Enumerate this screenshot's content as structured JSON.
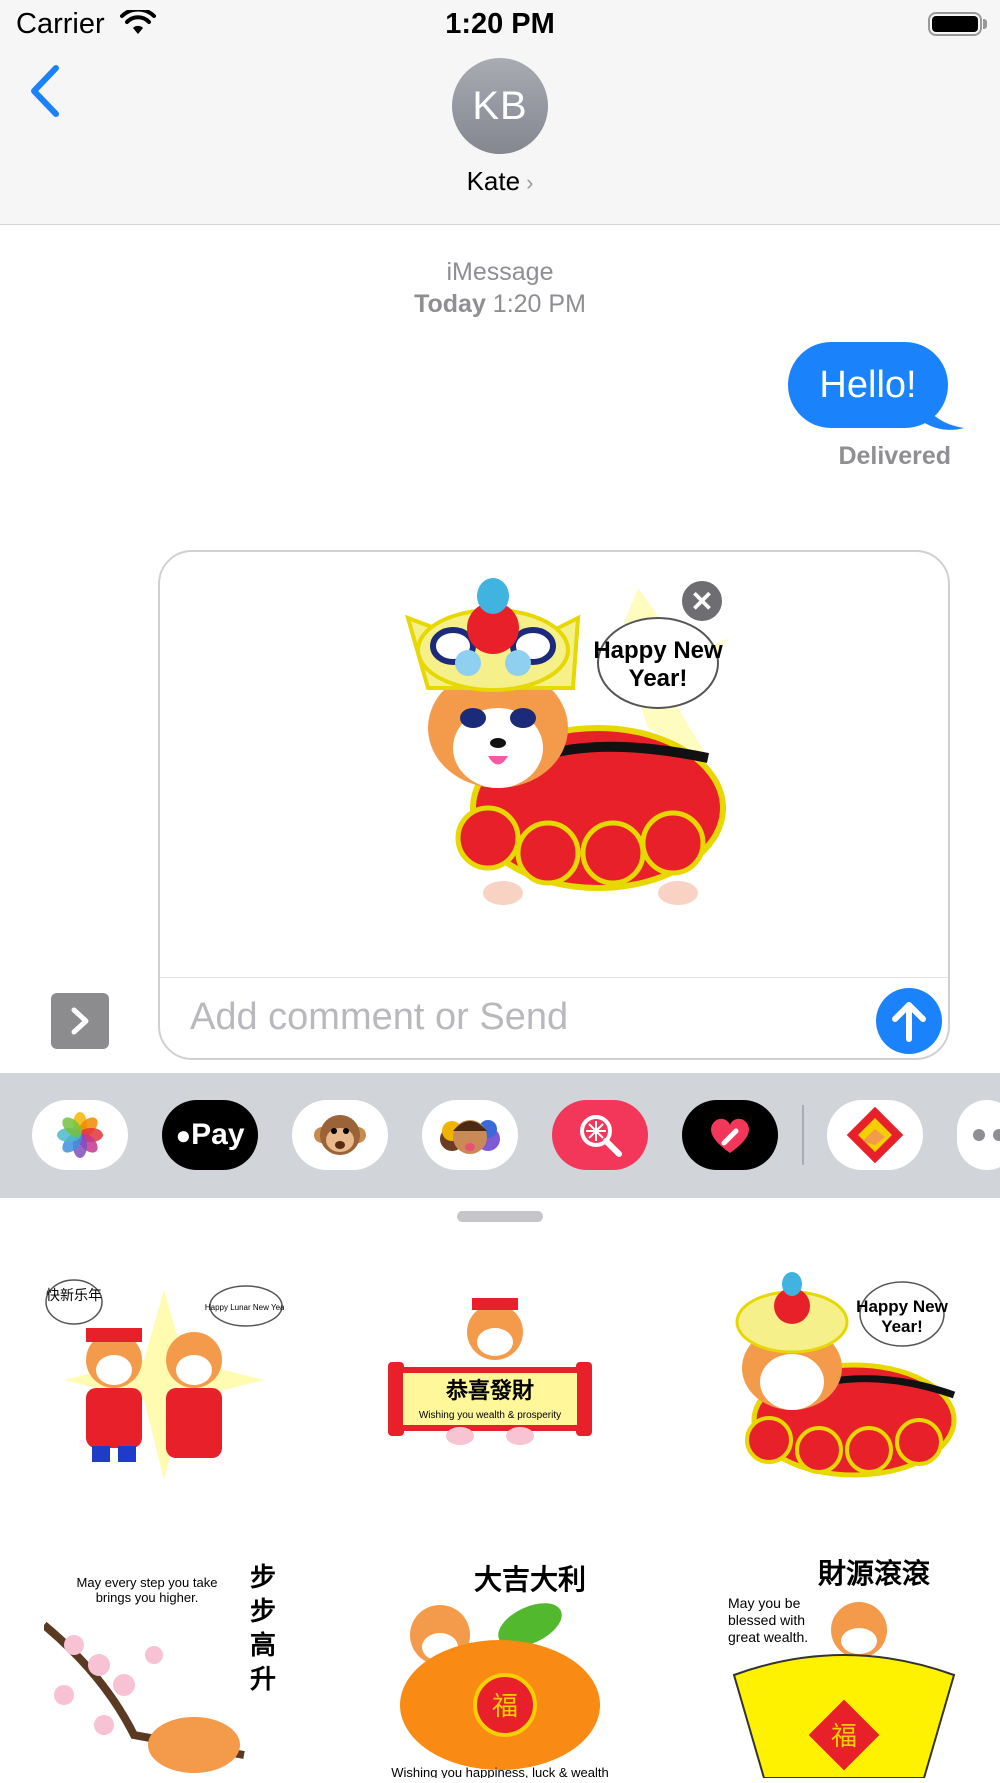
{
  "status_bar": {
    "carrier": "Carrier",
    "time": "1:20 PM"
  },
  "header": {
    "avatar_initials": "KB",
    "contact_name": "Kate",
    "contact_chevron": "›"
  },
  "conversation": {
    "service": "iMessage",
    "timestamp_day": "Today",
    "timestamp_time": "1:20 PM",
    "messages": [
      {
        "text": "Hello!",
        "direction": "outgoing",
        "status": "Delivered"
      }
    ]
  },
  "compose": {
    "preview_sticker": {
      "text_line1": "Happy New",
      "text_line2": "Year!"
    },
    "placeholder": "Add comment or Send"
  },
  "app_strip": {
    "apps": [
      {
        "name": "Photos",
        "icon": "photos-icon"
      },
      {
        "name": "Apple Pay",
        "icon": "apple-pay-icon",
        "label": "Pay"
      },
      {
        "name": "Animoji",
        "icon": "monkey-icon"
      },
      {
        "name": "Memoji",
        "icon": "memoji-icon"
      },
      {
        "name": "Search Images",
        "icon": "image-search-icon"
      },
      {
        "name": "Digital Touch",
        "icon": "digital-touch-icon"
      },
      {
        "name": "Sticker App",
        "icon": "corgi-sticker-app-icon"
      },
      {
        "name": "More",
        "icon": "more-icon"
      }
    ]
  },
  "stickers": [
    {
      "name": "lunar-new-year-couple",
      "text_a": "快新乐年",
      "text_b": "Happy Lunar New Year"
    },
    {
      "name": "gong-xi-fa-cai",
      "text_a": "恭喜發財",
      "text_b": "Wishing you wealth & prosperity"
    },
    {
      "name": "lion-dance",
      "text_a": "Happy New",
      "text_b": "Year!"
    },
    {
      "name": "bu-bu-gao-sheng",
      "text_a": "May every step you take brings you higher.",
      "text_b": "步步高升"
    },
    {
      "name": "da-ji-da-li",
      "text_a": "大吉大利",
      "text_b": "Wishing you happiness, luck & wealth",
      "text_c": "福"
    },
    {
      "name": "cai-yuan-gun-gun",
      "text_a": "財源滾滾",
      "text_b": "May you be blessed with great wealth.",
      "text_c": "福"
    }
  ],
  "colors": {
    "accent": "#1a82fb",
    "bubble": "#1a82fb",
    "strip": "#d1d4d9",
    "header": "#f6f6f6"
  }
}
